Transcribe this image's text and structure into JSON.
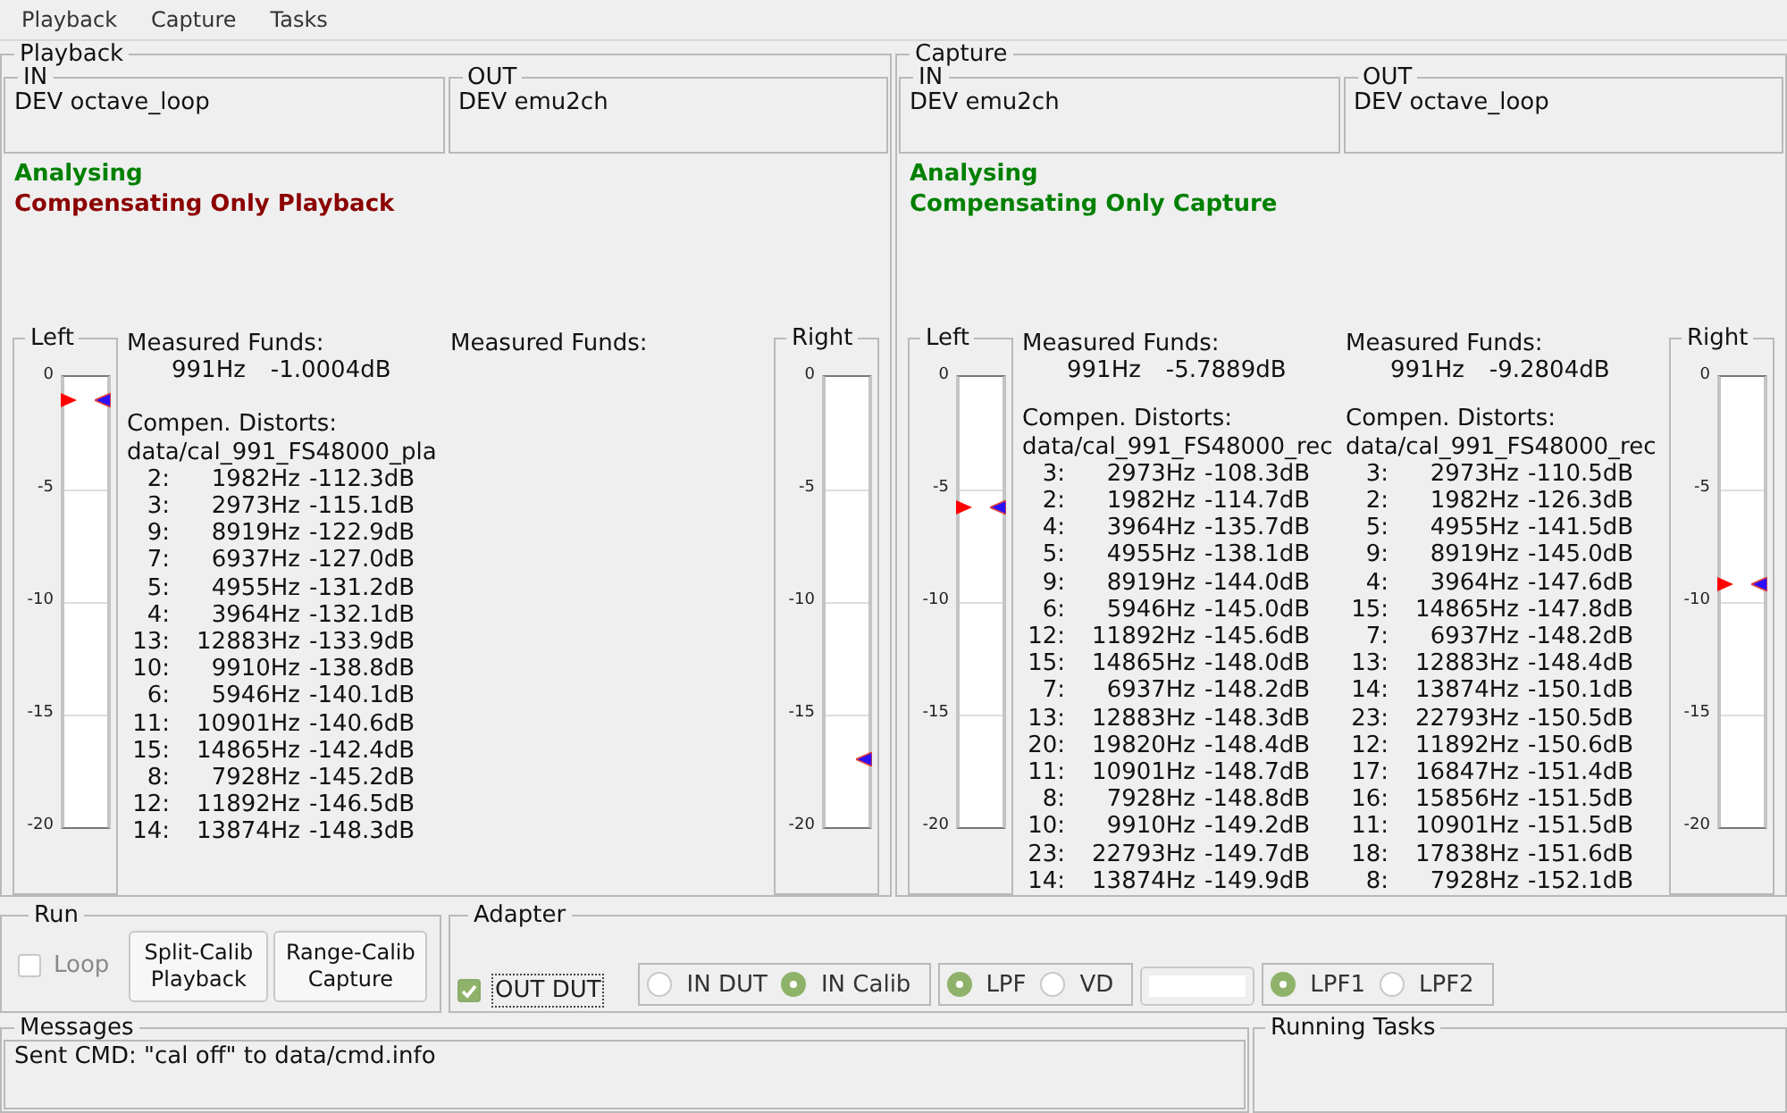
{
  "menu": [
    {
      "label": "Playback"
    },
    {
      "label": "Capture"
    },
    {
      "label": "Tasks"
    }
  ],
  "panels": [
    {
      "title": "Playback",
      "in": {
        "label": "IN",
        "device": "DEV octave_loop"
      },
      "out": {
        "label": "OUT",
        "device": "DEV emu2ch"
      },
      "status": [
        {
          "text": "Analysing",
          "color": "#008000"
        },
        {
          "text": "Compensating Only Playback",
          "color": "#8b0000"
        }
      ],
      "meters": [
        {
          "label": "Left",
          "ticks": [
            "0",
            "-5",
            "-10",
            "-15",
            "-20"
          ],
          "markers": [
            {
              "kind": "left",
              "level": 0.95
            },
            {
              "kind": "right",
              "level": 0.95
            }
          ]
        },
        {
          "label": "Right",
          "ticks": [
            "0",
            "-5",
            "-10",
            "-15",
            "-20"
          ],
          "markers": [
            {
              "kind": "right",
              "level": 0.15
            }
          ]
        }
      ],
      "channels": [
        {
          "heading": "Measured Funds:",
          "fund": {
            "freq": "991Hz",
            "db": "-1.0004dB"
          },
          "distorts_heading": "Compen. Distorts:",
          "file": "data/cal_991_FS48000_pla",
          "rows": [
            {
              "n": "2:",
              "freq": "1982Hz",
              "db": "-112.3dB"
            },
            {
              "n": "3:",
              "freq": "2973Hz",
              "db": "-115.1dB"
            },
            {
              "n": "9:",
              "freq": "8919Hz",
              "db": "-122.9dB"
            },
            {
              "n": "7:",
              "freq": "6937Hz",
              "db": "-127.0dB"
            },
            {
              "n": "5:",
              "freq": "4955Hz",
              "db": "-131.2dB"
            },
            {
              "n": "4:",
              "freq": "3964Hz",
              "db": "-132.1dB"
            },
            {
              "n": "13:",
              "freq": "12883Hz",
              "db": "-133.9dB"
            },
            {
              "n": "10:",
              "freq": "9910Hz",
              "db": "-138.8dB"
            },
            {
              "n": "6:",
              "freq": "5946Hz",
              "db": "-140.1dB"
            },
            {
              "n": "11:",
              "freq": "10901Hz",
              "db": "-140.6dB"
            },
            {
              "n": "15:",
              "freq": "14865Hz",
              "db": "-142.4dB"
            },
            {
              "n": "8:",
              "freq": "7928Hz",
              "db": "-145.2dB"
            },
            {
              "n": "12:",
              "freq": "11892Hz",
              "db": "-146.5dB"
            },
            {
              "n": "14:",
              "freq": "13874Hz",
              "db": "-148.3dB"
            }
          ]
        },
        {
          "heading": "Measured Funds:"
        }
      ]
    },
    {
      "title": "Capture",
      "in": {
        "label": "IN",
        "device": "DEV emu2ch"
      },
      "out": {
        "label": "OUT",
        "device": "DEV octave_loop"
      },
      "status": [
        {
          "text": "Analysing",
          "color": "#008000"
        },
        {
          "text": "Compensating Only Capture",
          "color": "#008000"
        }
      ],
      "meters": [
        {
          "label": "Left",
          "ticks": [
            "0",
            "-5",
            "-10",
            "-15",
            "-20"
          ],
          "markers": [
            {
              "kind": "left",
              "level": 0.71
            },
            {
              "kind": "right",
              "level": 0.71
            }
          ]
        },
        {
          "label": "Right",
          "ticks": [
            "0",
            "-5",
            "-10",
            "-15",
            "-20"
          ],
          "markers": [
            {
              "kind": "left",
              "level": 0.54
            },
            {
              "kind": "right",
              "level": 0.54
            }
          ]
        }
      ],
      "channels": [
        {
          "heading": "Measured Funds:",
          "fund": {
            "freq": "991Hz",
            "db": "-5.7889dB"
          },
          "distorts_heading": "Compen. Distorts:",
          "file": "data/cal_991_FS48000_rec",
          "rows": [
            {
              "n": "3:",
              "freq": "2973Hz",
              "db": "-108.3dB"
            },
            {
              "n": "2:",
              "freq": "1982Hz",
              "db": "-114.7dB"
            },
            {
              "n": "4:",
              "freq": "3964Hz",
              "db": "-135.7dB"
            },
            {
              "n": "5:",
              "freq": "4955Hz",
              "db": "-138.1dB"
            },
            {
              "n": "9:",
              "freq": "8919Hz",
              "db": "-144.0dB"
            },
            {
              "n": "6:",
              "freq": "5946Hz",
              "db": "-145.0dB"
            },
            {
              "n": "12:",
              "freq": "11892Hz",
              "db": "-145.6dB"
            },
            {
              "n": "15:",
              "freq": "14865Hz",
              "db": "-148.0dB"
            },
            {
              "n": "7:",
              "freq": "6937Hz",
              "db": "-148.2dB"
            },
            {
              "n": "13:",
              "freq": "12883Hz",
              "db": "-148.3dB"
            },
            {
              "n": "20:",
              "freq": "19820Hz",
              "db": "-148.4dB"
            },
            {
              "n": "11:",
              "freq": "10901Hz",
              "db": "-148.7dB"
            },
            {
              "n": "8:",
              "freq": "7928Hz",
              "db": "-148.8dB"
            },
            {
              "n": "10:",
              "freq": "9910Hz",
              "db": "-149.2dB"
            },
            {
              "n": "23:",
              "freq": "22793Hz",
              "db": "-149.7dB"
            },
            {
              "n": "14:",
              "freq": "13874Hz",
              "db": "-149.9dB"
            }
          ]
        },
        {
          "heading": "Measured Funds:",
          "fund": {
            "freq": "991Hz",
            "db": "-9.2804dB"
          },
          "distorts_heading": "Compen. Distorts:",
          "file": "data/cal_991_FS48000_rec",
          "rows": [
            {
              "n": "3:",
              "freq": "2973Hz",
              "db": "-110.5dB"
            },
            {
              "n": "2:",
              "freq": "1982Hz",
              "db": "-126.3dB"
            },
            {
              "n": "5:",
              "freq": "4955Hz",
              "db": "-141.5dB"
            },
            {
              "n": "9:",
              "freq": "8919Hz",
              "db": "-145.0dB"
            },
            {
              "n": "4:",
              "freq": "3964Hz",
              "db": "-147.6dB"
            },
            {
              "n": "15:",
              "freq": "14865Hz",
              "db": "-147.8dB"
            },
            {
              "n": "7:",
              "freq": "6937Hz",
              "db": "-148.2dB"
            },
            {
              "n": "13:",
              "freq": "12883Hz",
              "db": "-148.4dB"
            },
            {
              "n": "14:",
              "freq": "13874Hz",
              "db": "-150.1dB"
            },
            {
              "n": "23:",
              "freq": "22793Hz",
              "db": "-150.5dB"
            },
            {
              "n": "12:",
              "freq": "11892Hz",
              "db": "-150.6dB"
            },
            {
              "n": "17:",
              "freq": "16847Hz",
              "db": "-151.4dB"
            },
            {
              "n": "16:",
              "freq": "15856Hz",
              "db": "-151.5dB"
            },
            {
              "n": "11:",
              "freq": "10901Hz",
              "db": "-151.5dB"
            },
            {
              "n": "18:",
              "freq": "17838Hz",
              "db": "-151.6dB"
            },
            {
              "n": "8:",
              "freq": "7928Hz",
              "db": "-152.1dB"
            }
          ]
        }
      ]
    }
  ],
  "run": {
    "title": "Run",
    "loop": {
      "label": "Loop",
      "checked": false,
      "disabled": true
    },
    "buttons": [
      {
        "label": "Split-Calib Playback"
      },
      {
        "label": "Range-Calib Capture"
      }
    ]
  },
  "adapter": {
    "title": "Adapter",
    "out_dut": {
      "label": "OUT DUT",
      "checked": true,
      "focused": true
    },
    "controls": [
      {
        "kind": "radios",
        "options": [
          {
            "label": "IN DUT",
            "selected": false
          },
          {
            "label": "IN Calib",
            "selected": true
          }
        ]
      },
      {
        "kind": "radios",
        "options": [
          {
            "label": "LPF",
            "selected": true
          },
          {
            "label": "VD",
            "selected": false
          }
        ]
      },
      {
        "kind": "field"
      },
      {
        "kind": "radios",
        "options": [
          {
            "label": "LPF1",
            "selected": true
          },
          {
            "label": "LPF2",
            "selected": false
          }
        ]
      }
    ]
  },
  "messages": {
    "title": "Messages",
    "lines": [
      "Sent CMD: \"cal off\" to data/cmd.info"
    ]
  },
  "running_tasks": {
    "title": "Running Tasks"
  }
}
